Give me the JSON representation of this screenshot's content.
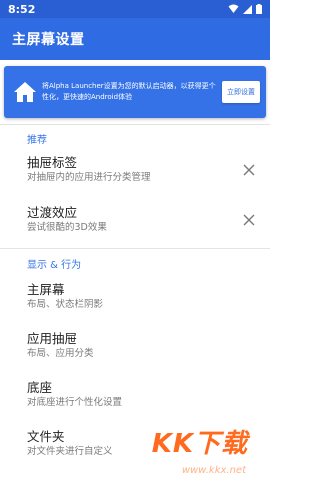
{
  "status": {
    "time": "8:52"
  },
  "app_bar": {
    "title": "主屏幕设置"
  },
  "banner": {
    "text": "将Alpha Launcher设置为您的默认启动器，以获得更个性化，更快速的Android体验",
    "button": "立即设置"
  },
  "sections": {
    "recommended": "推荐",
    "display": "显示 & 行为"
  },
  "items": [
    {
      "title": "抽屉标签",
      "subtitle": "对抽屉内的应用进行分类管理"
    },
    {
      "title": "过渡效应",
      "subtitle": "尝试很酷的3D效果"
    },
    {
      "title": "主屏幕",
      "subtitle": "布局、状态栏阴影"
    },
    {
      "title": "应用抽屉",
      "subtitle": "布局、应用分类"
    },
    {
      "title": "底座",
      "subtitle": "对底座进行个性化设置"
    },
    {
      "title": "文件夹",
      "subtitle": "对文件夹进行自定义"
    }
  ],
  "watermark": {
    "text": "KK下载",
    "url": "www.kkx.net"
  },
  "colors": {
    "primary": "#2f6be3",
    "status_bar": "#2a5fd4",
    "accent": "#3576e8"
  }
}
